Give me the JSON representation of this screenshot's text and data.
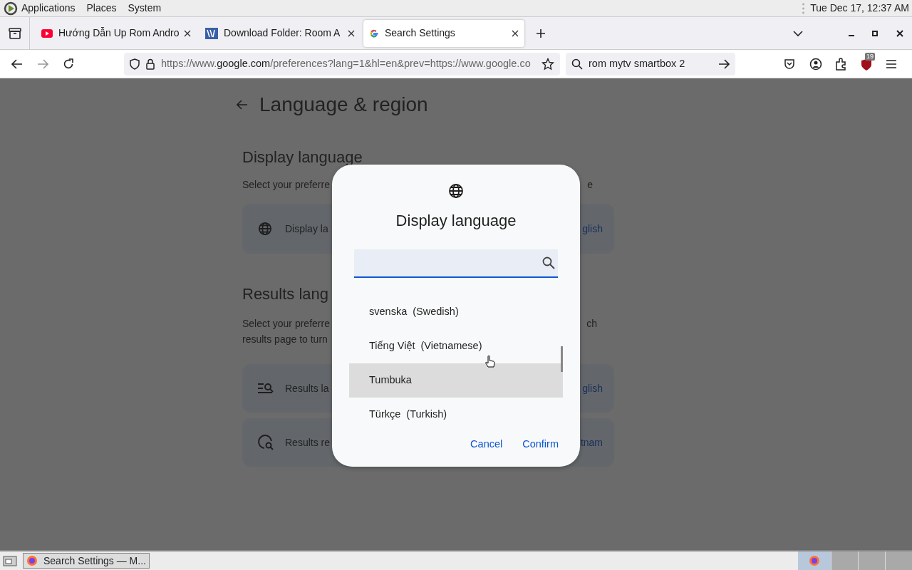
{
  "top_panel": {
    "menus": [
      "Applications",
      "Places",
      "System"
    ],
    "clock": "Tue Dec 17, 12:37 AM"
  },
  "tabs": [
    {
      "title": "Hướng Dẫn Up Rom Andro",
      "selected": false
    },
    {
      "title": "Download Folder: Room A",
      "selected": false
    },
    {
      "title": "Search Settings",
      "selected": true
    }
  ],
  "address_bar": {
    "scheme": "https://www.",
    "domain": "google.com",
    "path": "/preferences?lang=1&hl=en&prev=https://www.google.co"
  },
  "search_bar": {
    "value": "rom mytv smartbox 2"
  },
  "extension_badge": "19",
  "page": {
    "title": "Language & region",
    "display_section": {
      "heading": "Display language",
      "description": {
        "left": "Select your preferre",
        "right": "e"
      },
      "row": {
        "label": "Display la",
        "value": "glish"
      }
    },
    "results_section": {
      "heading": "Results lang",
      "description_lines": [
        {
          "left": "Select your preferre",
          "right": "ch"
        },
        {
          "left": "results page to turn"
        }
      ],
      "rows": [
        {
          "label": "Results la",
          "value": "glish"
        },
        {
          "label": "Results re",
          "value": "tnam"
        }
      ]
    }
  },
  "dialog": {
    "title": "Display language",
    "languages": [
      {
        "name": "svenska  (Swedish)",
        "highlighted": false
      },
      {
        "name": "Tiếng Việt  (Vietnamese)",
        "highlighted": false
      },
      {
        "name": "Tumbuka",
        "highlighted": true
      },
      {
        "name": "Türkçe  (Turkish)",
        "highlighted": false
      }
    ],
    "buttons": [
      "Cancel",
      "Confirm"
    ]
  },
  "taskbar": {
    "task": "Search Settings — M..."
  }
}
